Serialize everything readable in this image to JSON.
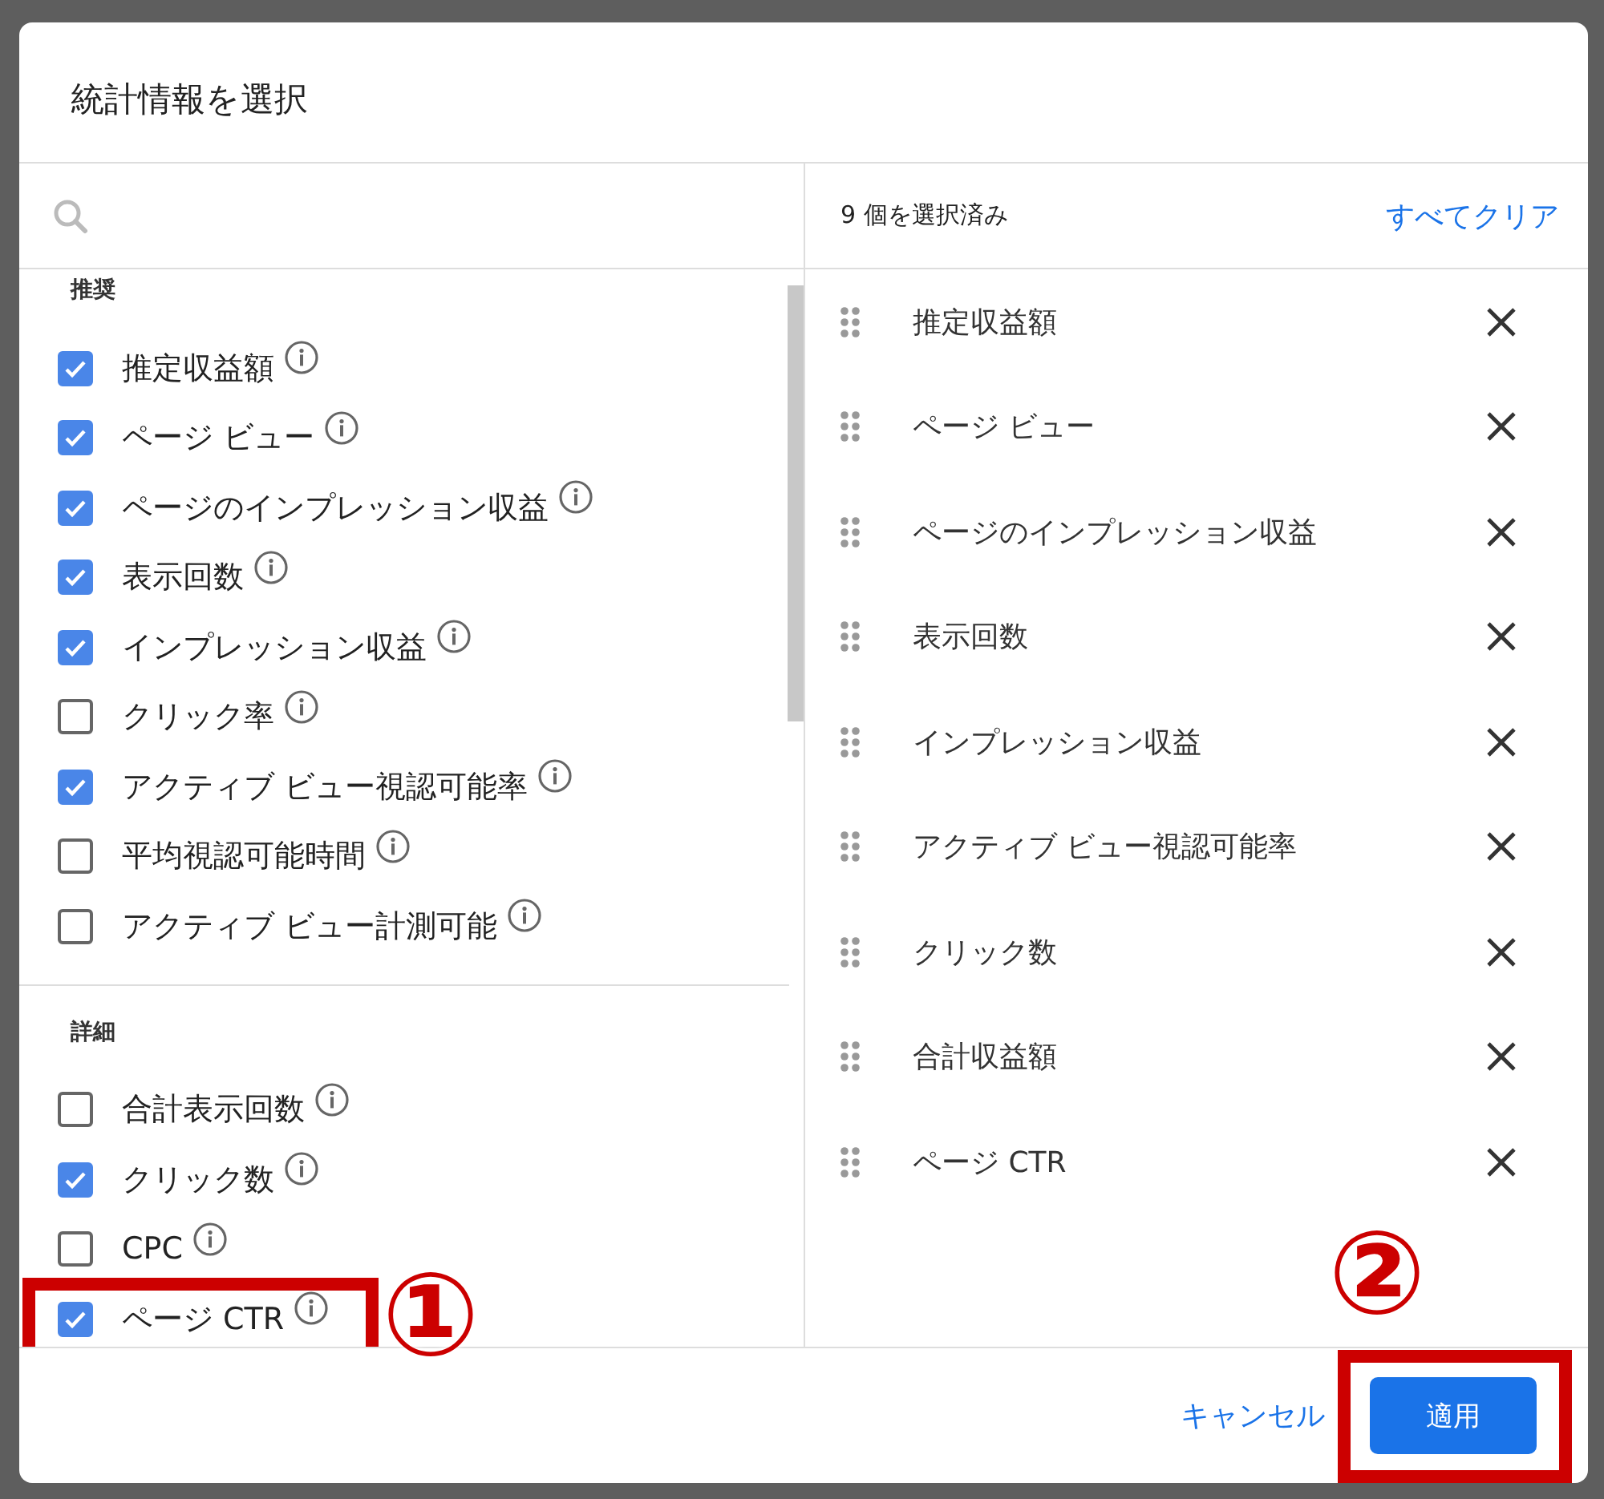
{
  "dialog": {
    "title": "統計情報を選択"
  },
  "sections": [
    {
      "heading": "推奨",
      "items": [
        {
          "label": "推定収益額",
          "checked": true,
          "highlighted": false
        },
        {
          "label": "ページ ビュー",
          "checked": true,
          "highlighted": false
        },
        {
          "label": "ページのインプレッション収益",
          "checked": true,
          "highlighted": false
        },
        {
          "label": "表示回数",
          "checked": true,
          "highlighted": false
        },
        {
          "label": "インプレッション収益",
          "checked": true,
          "highlighted": false
        },
        {
          "label": "クリック率",
          "checked": false,
          "highlighted": false
        },
        {
          "label": "アクティブ ビュー視認可能率",
          "checked": true,
          "highlighted": false
        },
        {
          "label": "平均視認可能時間",
          "checked": false,
          "highlighted": false
        },
        {
          "label": "アクティブ ビュー計測可能",
          "checked": false,
          "highlighted": false
        }
      ]
    },
    {
      "heading": "詳細",
      "items": [
        {
          "label": "合計表示回数",
          "checked": false,
          "highlighted": false
        },
        {
          "label": "クリック数",
          "checked": true,
          "highlighted": false
        },
        {
          "label": "CPC",
          "checked": false,
          "highlighted": false
        },
        {
          "label": "ページ CTR",
          "checked": true,
          "highlighted": true
        }
      ]
    }
  ],
  "selected_panel": {
    "count": "9 個を選択済み",
    "clear_all": "すべてクリア",
    "items": [
      {
        "label": "推定収益額"
      },
      {
        "label": "ページ ビュー"
      },
      {
        "label": "ページのインプレッション収益"
      },
      {
        "label": "表示回数"
      },
      {
        "label": "インプレッション収益"
      },
      {
        "label": "アクティブ ビュー視認可能率"
      },
      {
        "label": "クリック数"
      },
      {
        "label": "合計収益額"
      },
      {
        "label": "ページ CTR"
      }
    ]
  },
  "footer": {
    "cancel": "キャンセル",
    "apply": "適用",
    "apply_highlighted": true
  },
  "annotations": [
    {
      "label": "①"
    },
    {
      "label": "②"
    }
  ]
}
